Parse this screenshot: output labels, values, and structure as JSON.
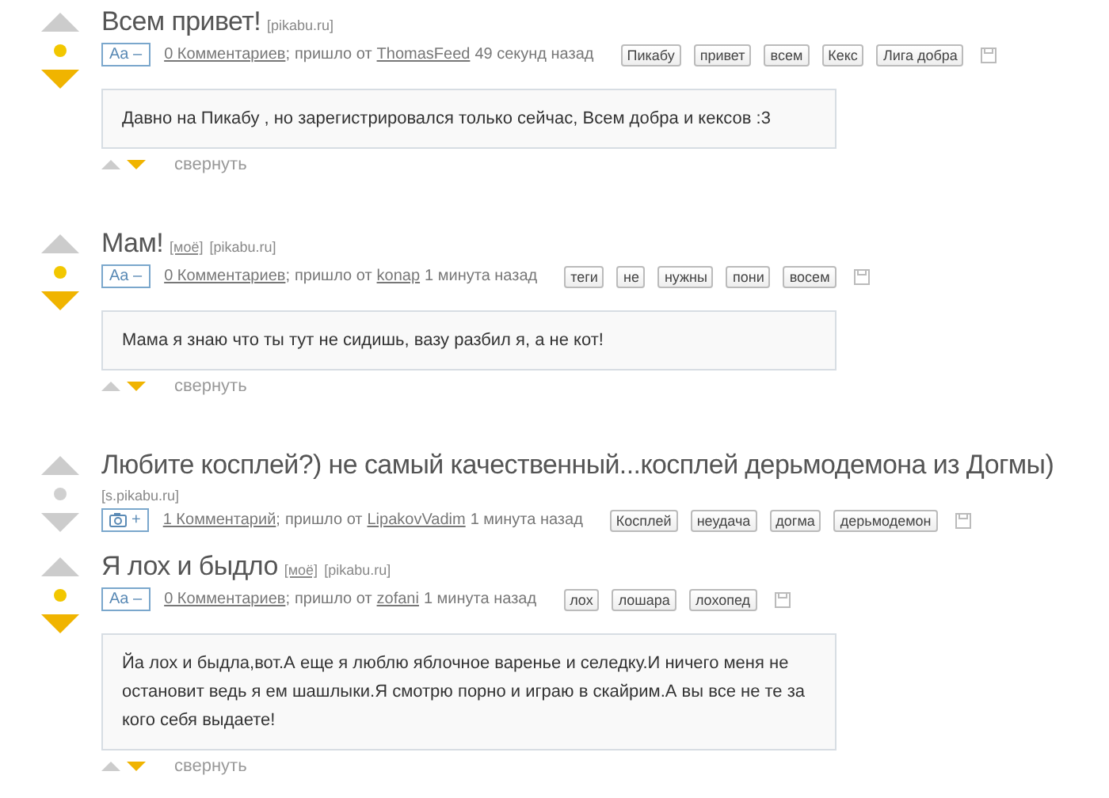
{
  "posts": [
    {
      "title": "Всем привет!",
      "source": "[pikabu.ru]",
      "badge": {
        "kind": "text",
        "label": "Aa –"
      },
      "comments": "0 Комментариев",
      "sep": ";",
      "from": "пришло от",
      "author": "ThomasFeed",
      "time": "49 секунд назад",
      "tags": [
        "Пикабу",
        "привет",
        "всем",
        "Кекс",
        "Лига добра"
      ],
      "color": "#f2c700",
      "voted_down": true,
      "body": "Давно на Пикабу , но зарегистрировался только сейчас, Всем добра и кексов :3",
      "collapse": "свернуть"
    },
    {
      "title": "Мам!",
      "mine": "[моё]",
      "source": "[pikabu.ru]",
      "badge": {
        "kind": "text",
        "label": "Aa –"
      },
      "comments": "0 Комментариев",
      "sep": ";",
      "from": "пришло от",
      "author": "konap",
      "time": "1 минута назад",
      "tags": [
        "теги",
        "не",
        "нужны",
        "пони",
        "восем"
      ],
      "color": "#f2c700",
      "voted_down": true,
      "body": "Мама я знаю что ты тут не сидишь, вазу разбил я, а не кот!",
      "collapse": "свернуть"
    },
    {
      "title": "Любите косплей?) не самый качественный...косплей дерьмодемона из Догмы)",
      "source": "[s.pikabu.ru]",
      "badge": {
        "kind": "photo",
        "label": "+"
      },
      "comments": "1 Комментарий",
      "sep": ";",
      "from": "пришло от",
      "author": "LipakovVadim",
      "time": "1 минута назад",
      "tags": [
        "Косплей",
        "неудача",
        "догма",
        "дерьмодемон"
      ],
      "color": "#d0d0d0",
      "voted_down": false
    },
    {
      "title": "Я лох и быдло",
      "mine": "[моё]",
      "source": "[pikabu.ru]",
      "badge": {
        "kind": "text",
        "label": "Aa –"
      },
      "comments": "0 Комментариев",
      "sep": ";",
      "from": "пришло от",
      "author": "zofani",
      "time": "1 минута назад",
      "tags": [
        "лох",
        "лошара",
        "лохопед"
      ],
      "color": "#f2c700",
      "voted_down": true,
      "body": "Йа лох и быдла,вот.А еще я люблю яблочное варенье и селедку.И ничего меня не остановит ведь я ем шашлыки.Я смотрю порно и играю в скайрим.А вы все не те за кого себя выдаете!",
      "collapse": "свернуть"
    }
  ]
}
